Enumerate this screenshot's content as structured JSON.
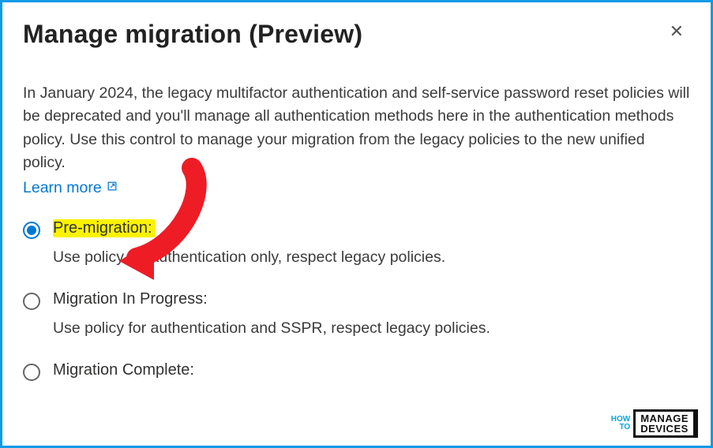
{
  "header": {
    "title": "Manage migration (Preview)"
  },
  "description": "In January 2024, the legacy multifactor authentication and self-service password reset policies will be deprecated and you'll manage all authentication methods here in the authentication methods policy. Use this control to manage your migration from the legacy policies to the new unified policy.",
  "learn_more": "Learn more",
  "options": [
    {
      "label": "Pre-migration:",
      "sub": "Use policy for authentication only, respect legacy policies.",
      "selected": true,
      "highlighted": true
    },
    {
      "label": "Migration In Progress:",
      "sub": "Use policy for authentication and SSPR, respect legacy policies.",
      "selected": false,
      "highlighted": false
    },
    {
      "label": "Migration Complete:",
      "sub": "",
      "selected": false,
      "highlighted": false
    }
  ],
  "watermark": {
    "how": "HOW",
    "to": "TO",
    "manage": "MANAGE",
    "devices": "DEVICES"
  }
}
